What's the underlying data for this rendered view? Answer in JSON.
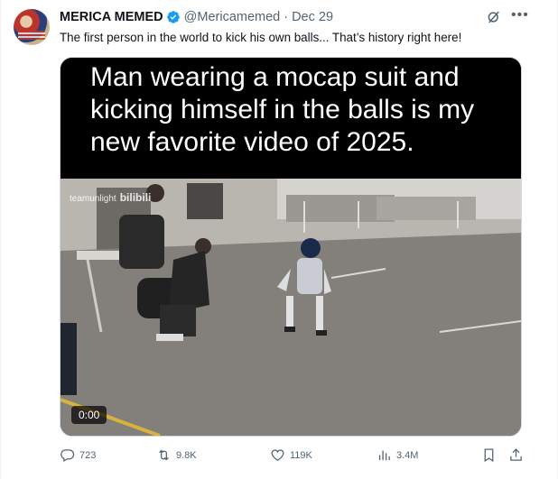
{
  "tweet": {
    "author": {
      "display_name": "MERICA MEMED",
      "handle": "@Mericamemed",
      "separator": "·",
      "date": "Dec 29"
    },
    "text": "The first person in the world to kick his own balls... That’s history right here!",
    "media": {
      "caption": "Man wearing a mocap suit and kicking himself in the balls is my new favorite video of 2025.",
      "watermark": "teamunlight",
      "watermark_brand": "bilibili",
      "timestamp": "0:00"
    },
    "actions": {
      "replies": "723",
      "reposts": "9.8K",
      "likes": "119K",
      "views": "3.4M"
    }
  },
  "colors": {
    "text": "#0f1419",
    "secondary": "#536471",
    "verified": "#1d9bf0",
    "media_bg": "#000000"
  },
  "icons": [
    "verified-badge-icon",
    "grok-icon",
    "more-icon",
    "reply-icon",
    "repost-icon",
    "like-icon",
    "views-icon",
    "bookmark-icon",
    "share-icon"
  ]
}
